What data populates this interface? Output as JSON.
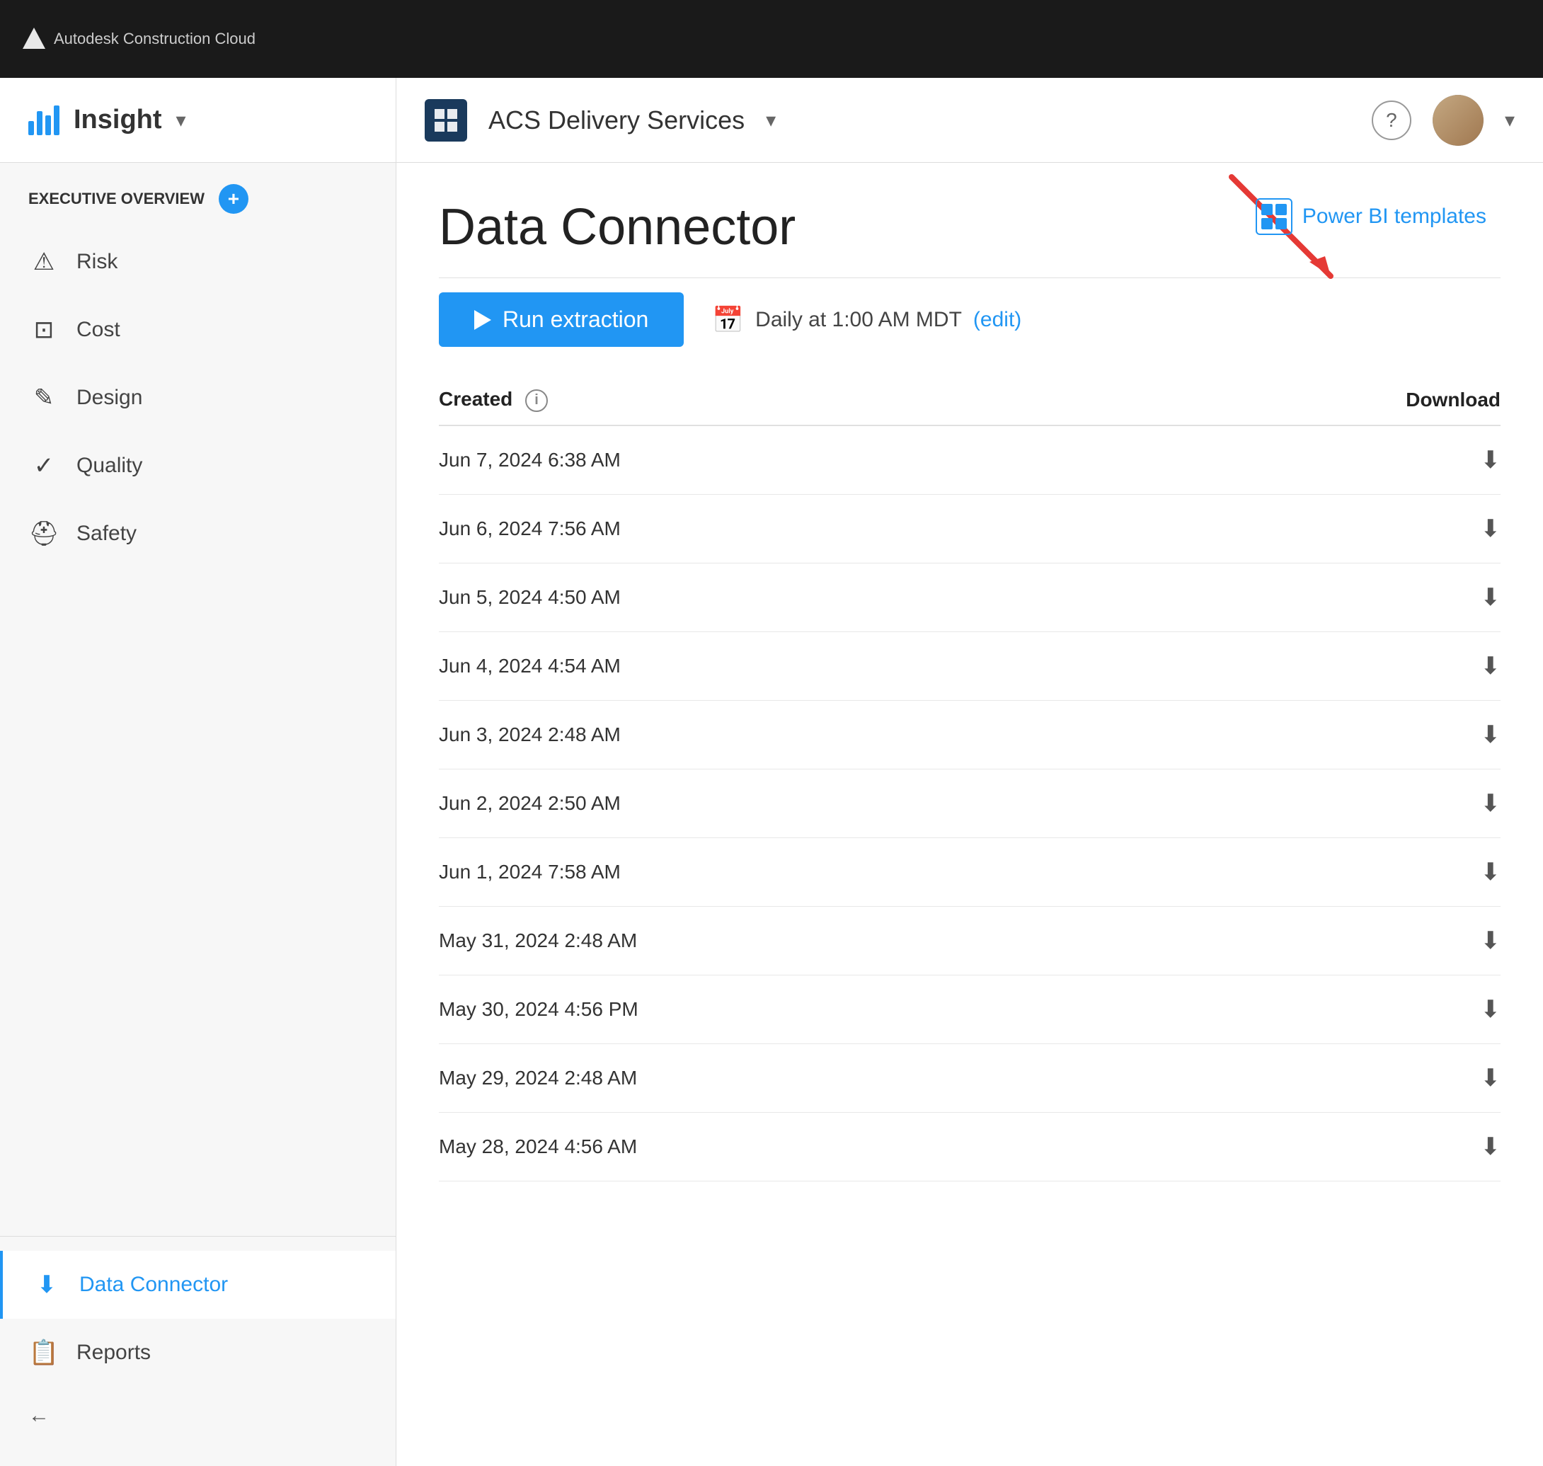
{
  "app": {
    "brand": "Autodesk Construction Cloud",
    "module": "Insight",
    "module_dropdown": "▾"
  },
  "header": {
    "project_name": "ACS Delivery Services",
    "project_dropdown": "▾",
    "help_label": "?",
    "avatar_alt": "User Avatar"
  },
  "sidebar": {
    "section_label": "EXECUTIVE OVERVIEW",
    "add_btn_label": "+",
    "nav_items": [
      {
        "id": "risk",
        "label": "Risk",
        "icon": "⚠"
      },
      {
        "id": "cost",
        "label": "Cost",
        "icon": "📷"
      },
      {
        "id": "design",
        "label": "Design",
        "icon": "✏"
      },
      {
        "id": "quality",
        "label": "Quality",
        "icon": "✓"
      },
      {
        "id": "safety",
        "label": "Safety",
        "icon": "⛑"
      }
    ],
    "bottom_items": [
      {
        "id": "data-connector",
        "label": "Data Connector",
        "icon": "⬇",
        "active": true
      },
      {
        "id": "reports",
        "label": "Reports",
        "icon": "📋",
        "active": false
      }
    ],
    "collapse_icon": "←"
  },
  "content": {
    "page_title": "Data Connector",
    "power_bi_link": "Power BI templates",
    "run_btn_label": "Run extraction",
    "schedule_text": "Daily at 1:00 AM MDT",
    "edit_label": "(edit)",
    "table": {
      "col_created": "Created",
      "col_download": "Download",
      "rows": [
        {
          "date": "Jun 7, 2024 6:38 AM"
        },
        {
          "date": "Jun 6, 2024 7:56 AM"
        },
        {
          "date": "Jun 5, 2024 4:50 AM"
        },
        {
          "date": "Jun 4, 2024 4:54 AM"
        },
        {
          "date": "Jun 3, 2024 2:48 AM"
        },
        {
          "date": "Jun 2, 2024 2:50 AM"
        },
        {
          "date": "Jun 1, 2024 7:58 AM"
        },
        {
          "date": "May 31, 2024 2:48 AM"
        },
        {
          "date": "May 30, 2024 4:56 PM"
        },
        {
          "date": "May 29, 2024 2:48 AM"
        },
        {
          "date": "May 28, 2024 4:56 AM"
        }
      ]
    }
  },
  "colors": {
    "primary": "#2196f3",
    "dark_bg": "#1a1a1a",
    "sidebar_bg": "#f7f7f7",
    "active_color": "#2196f3",
    "arrow_red": "#e53935"
  }
}
